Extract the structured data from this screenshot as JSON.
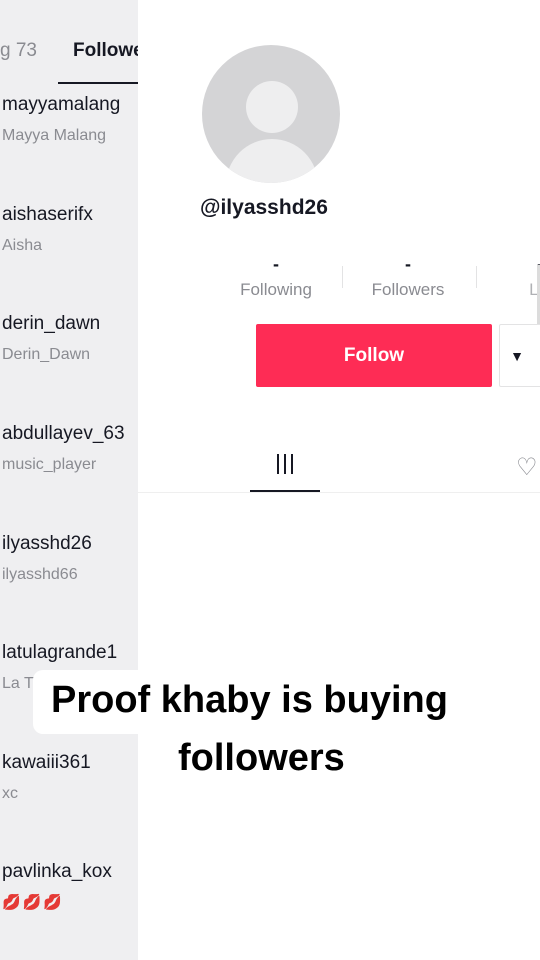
{
  "left_panel": {
    "tab_following": "g 73",
    "tab_followers": "Followe",
    "users": [
      {
        "username": "mayyamalang",
        "display_name": "Mayya Malang"
      },
      {
        "username": "aishaserifx",
        "display_name": "Aisha"
      },
      {
        "username": "derin_dawn",
        "display_name": "Derin_Dawn"
      },
      {
        "username": "abdullayev_63",
        "display_name": "music_player"
      },
      {
        "username": "ilyasshd26",
        "display_name": "ilyasshd66"
      },
      {
        "username": "latulagrande1",
        "display_name": "La T"
      },
      {
        "username": "kawaiii361",
        "display_name": "xc"
      },
      {
        "username": "pavlinka_kox",
        "display_name": "💋💋💋"
      }
    ]
  },
  "profile": {
    "handle": "@ilyasshd26",
    "stats": [
      {
        "value": "-",
        "label": "Following"
      },
      {
        "value": "-",
        "label": "Followers"
      },
      {
        "value": "-",
        "label": "Lik"
      }
    ],
    "follow_label": "Follow",
    "more_icon": "caret-down-icon",
    "grid_icon": "videos-grid-icon",
    "liked_icon": "heart-outline-icon"
  },
  "caption": {
    "line1": "Proof khaby is buying",
    "line2": "followers"
  },
  "colors": {
    "accent": "#fe2c55",
    "secondary_text": "#8a8b91",
    "panel_bg": "#efeff1"
  }
}
